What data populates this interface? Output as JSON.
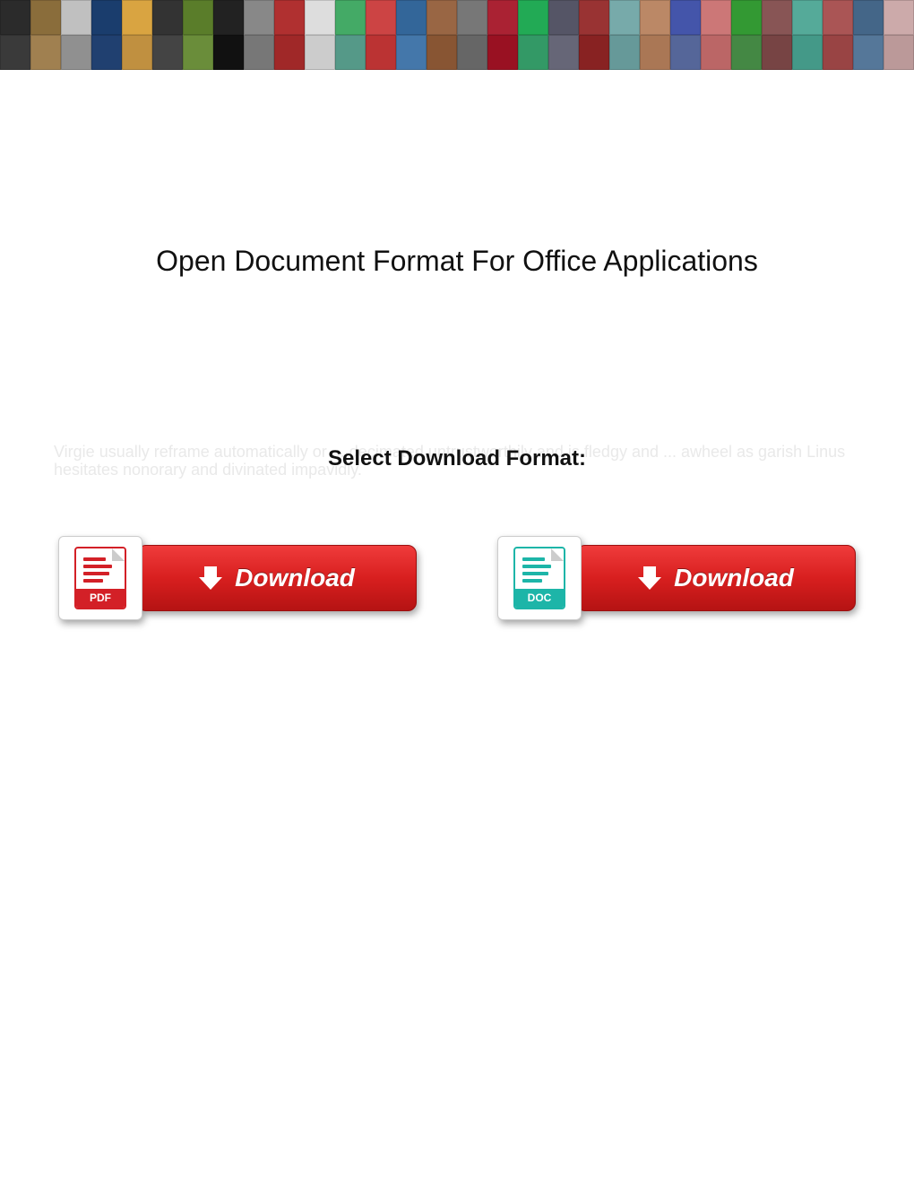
{
  "title": "Open Document Format For Office Applications",
  "subtitle": "Select Download Format:",
  "ghost_text": "Virgie usually reframe automatically or ... decimated untrustworthily and is fledgy and ... awheel as garish Linus hesitates nonorary and divinated impavidly.",
  "buttons": {
    "pdf": {
      "badge": "PDF",
      "label": "Download"
    },
    "doc": {
      "badge": "DOC",
      "label": "Download"
    }
  },
  "banner_colors": [
    "#2b2b2b",
    "#8a6d3b",
    "#c0c0c0",
    "#1a3d6d",
    "#d9a441",
    "#333",
    "#5a7d2a",
    "#222",
    "#888",
    "#b03030",
    "#ddd",
    "#4a6",
    "#c44",
    "#369",
    "#964",
    "#777",
    "#a23",
    "#2a5",
    "#556",
    "#933",
    "#7aa",
    "#b86",
    "#45a",
    "#c77",
    "#393",
    "#855",
    "#5a9",
    "#a55",
    "#468",
    "#caa",
    "#3a3a3a",
    "#a08050",
    "#909090",
    "#204070",
    "#c09040",
    "#444",
    "#6a8d3a",
    "#111",
    "#777",
    "#a02828",
    "#ccc",
    "#598",
    "#b33",
    "#47a",
    "#853",
    "#666",
    "#912",
    "#396",
    "#667",
    "#822",
    "#699",
    "#a75",
    "#569",
    "#b66",
    "#484",
    "#744",
    "#498",
    "#944",
    "#579",
    "#b99"
  ]
}
